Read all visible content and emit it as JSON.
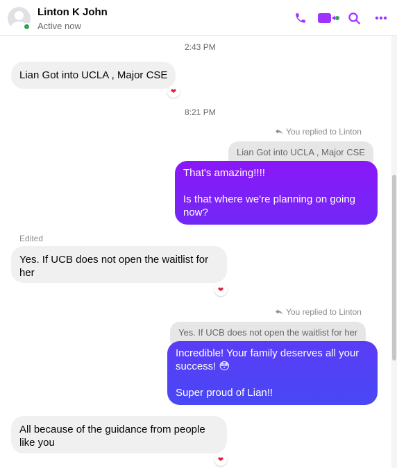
{
  "header": {
    "name": "Linton K John",
    "status": "Active now",
    "icons": [
      "phone-icon",
      "video-call-icon",
      "search-icon",
      "more-options-icon"
    ],
    "accent_color": "#a033ff"
  },
  "timestamps": [
    "2:43 PM",
    "8:21 PM"
  ],
  "messages": [
    {
      "text": "Lian Got into UCLA , Major CSE",
      "reaction": "❤"
    },
    {
      "reply_note": "You replied to Linton",
      "quoted": "Lian Got into UCLA , Major CSE",
      "text": "That's amazing!!!!\n\nIs that where we're planning on going now?"
    },
    {
      "edited_label": "Edited",
      "text": "Yes. If UCB does not open the waitlist for her",
      "reaction": "❤"
    },
    {
      "reply_note": "You replied to Linton",
      "quoted": "Yes. If UCB does not open the waitlist for her",
      "text": "Incredible! Your family deserves all your success! 😳\n\nSuper proud of Lian!!"
    },
    {
      "text": "All because of the guidance from people like you",
      "reaction": "❤"
    }
  ],
  "colors": {
    "outgoing_gradient_top": "#8a17f8",
    "outgoing_gradient_mid": "#5b3cf6",
    "outgoing_gradient_bottom": "#4848f5",
    "incoming_bubble": "#f0f0f0",
    "online": "#31a24c"
  }
}
